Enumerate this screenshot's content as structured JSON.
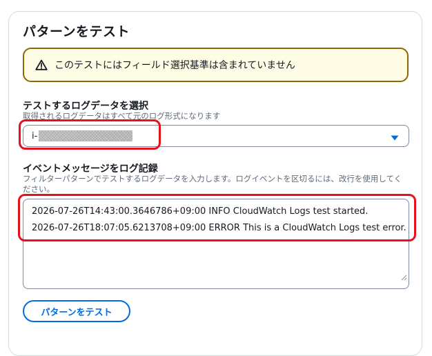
{
  "panel": {
    "title": "パターンをテスト"
  },
  "alert": {
    "icon": "warning-icon",
    "text": "このテストにはフィールド選択基準は含まれていません",
    "border_color": "#8d6605",
    "background_color": "#fffce6"
  },
  "log_data": {
    "label": "テストするログデータを選択",
    "description": "取得されるログデータはすべて元のログ形式になります",
    "selected_value": "i-"
  },
  "event_messages": {
    "label": "イベントメッセージをログ記録",
    "description": "フィルターパターンでテストするログデータを入力します。ログイベントを区切るには、改行を使用してください。",
    "lines": [
      "2026-07-26T14:43:00.3646786+09:00 INFO CloudWatch Logs test started.",
      "2026-07-26T18:07:05.6213708+09:00 ERROR This is a CloudWatch Logs test error."
    ]
  },
  "actions": {
    "test_pattern_label": "パターンをテスト"
  },
  "colors": {
    "accent": "#006ce0",
    "highlight": "#e8101b"
  }
}
